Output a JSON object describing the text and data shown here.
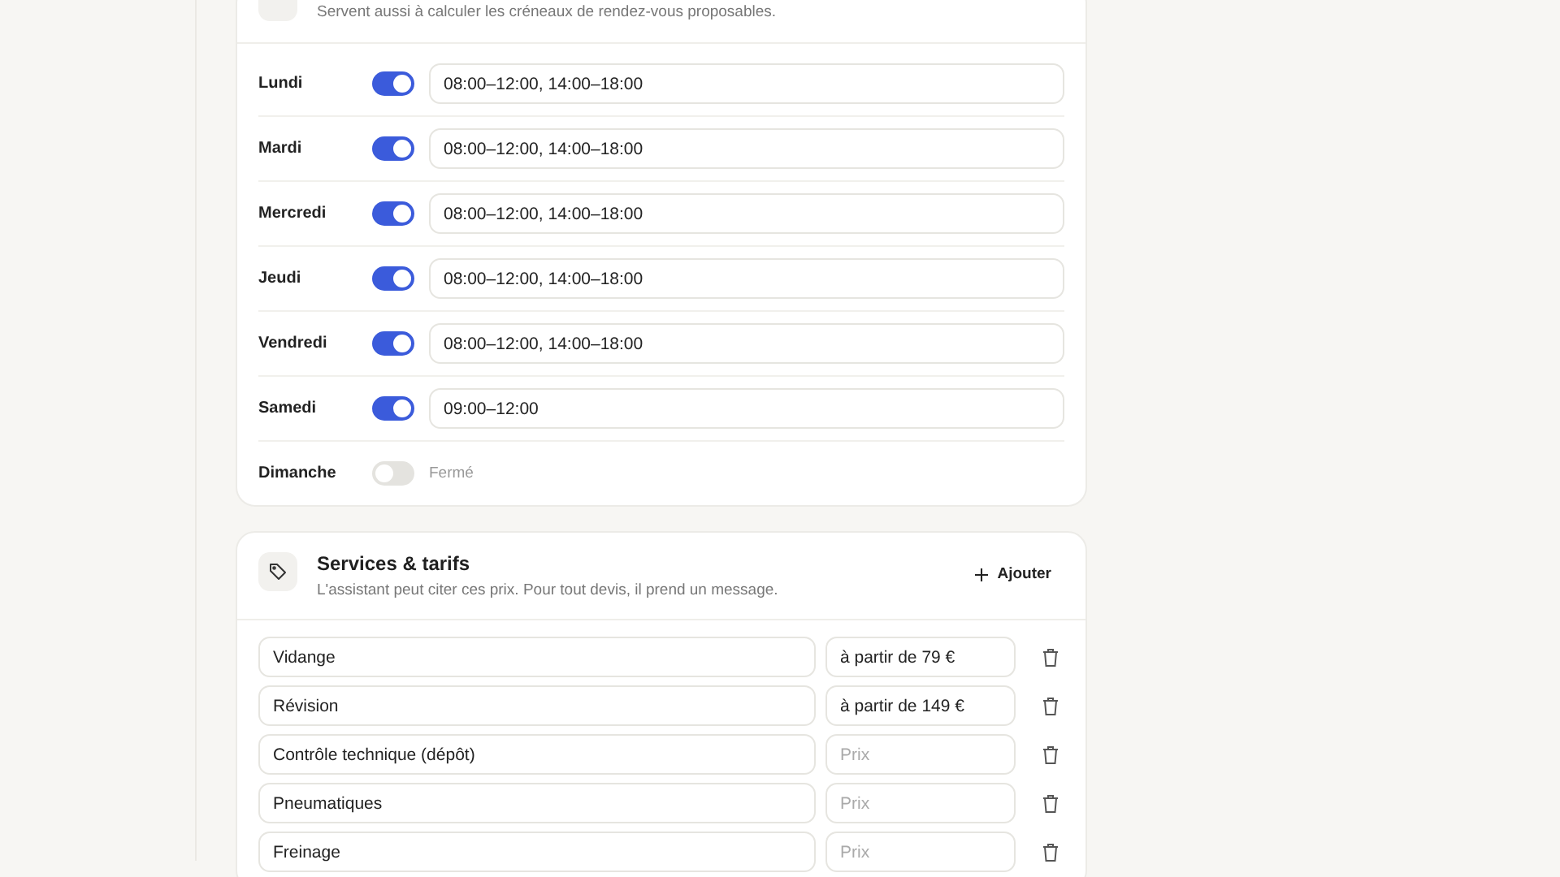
{
  "hours": {
    "subtitle": "Servent aussi à calculer les créneaux de rendez-vous proposables.",
    "days": [
      {
        "day": "Lundi",
        "open": true,
        "hours": "08:00–12:00, 14:00–18:00"
      },
      {
        "day": "Mardi",
        "open": true,
        "hours": "08:00–12:00, 14:00–18:00"
      },
      {
        "day": "Mercredi",
        "open": true,
        "hours": "08:00–12:00, 14:00–18:00"
      },
      {
        "day": "Jeudi",
        "open": true,
        "hours": "08:00–12:00, 14:00–18:00"
      },
      {
        "day": "Vendredi",
        "open": true,
        "hours": "08:00–12:00, 14:00–18:00"
      },
      {
        "day": "Samedi",
        "open": true,
        "hours": "09:00–12:00"
      },
      {
        "day": "Dimanche",
        "open": false,
        "closed_label": "Fermé"
      }
    ]
  },
  "services": {
    "title": "Services & tarifs",
    "subtitle": "L'assistant peut citer ces prix. Pour tout devis, il prend un message.",
    "add_button": "Ajouter",
    "items": [
      {
        "name": "Vidange",
        "price": "à partir de 79 €"
      },
      {
        "name": "Révision",
        "price": "à partir de 149 €"
      },
      {
        "name": "Contrôle technique (dépôt)",
        "price_placeholder": "Prix"
      },
      {
        "name": "Pneumatiques",
        "price_placeholder": "Prix"
      },
      {
        "name": "Freinage",
        "price_placeholder": "Prix"
      }
    ]
  }
}
